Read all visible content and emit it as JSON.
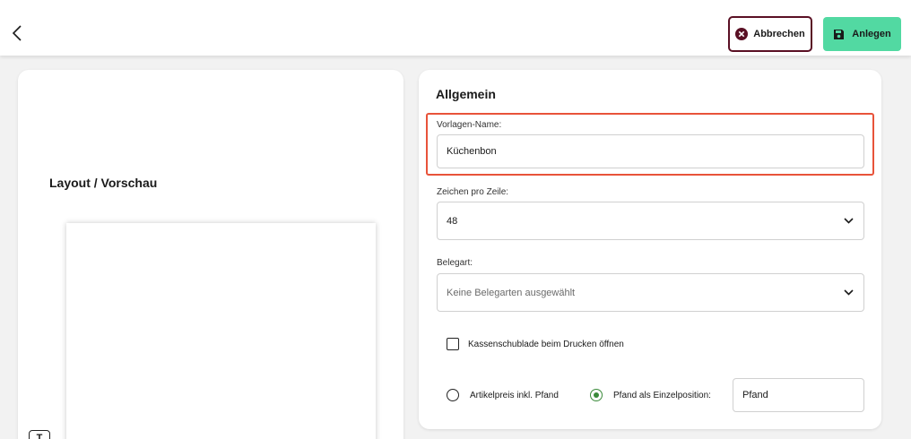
{
  "header": {
    "cancel_label": "Abbrechen",
    "save_label": "Anlegen",
    "icons": {
      "back": "chevron-left-icon",
      "cancel": "close-circle-icon",
      "save": "save-disk-icon"
    },
    "colors": {
      "cancel_border": "#5a1024",
      "save_bg": "#52d9a2"
    }
  },
  "preview": {
    "title": "Layout / Vorschau",
    "tool_icon": "T"
  },
  "general": {
    "section_title": "Allgemein",
    "template_name": {
      "label": "Vorlagen-Name:",
      "value": "Küchenbon"
    },
    "chars_per_line": {
      "label": "Zeichen pro Zeile:",
      "value": "48"
    },
    "document_type": {
      "label": "Belegart:",
      "placeholder": "Keine Belegarten ausgewählt"
    },
    "cash_drawer": {
      "label": "Kassenschublade beim Drucken öffnen",
      "checked": false
    },
    "deposit": {
      "option_incl": {
        "label": "Artikelpreis inkl. Pfand",
        "selected": false
      },
      "option_single": {
        "label": "Pfand als Einzelposition:",
        "selected": true
      },
      "position_name": "Pfand"
    },
    "colors": {
      "highlight": "#e8533a",
      "radio_active": "#3a8a3a"
    }
  }
}
